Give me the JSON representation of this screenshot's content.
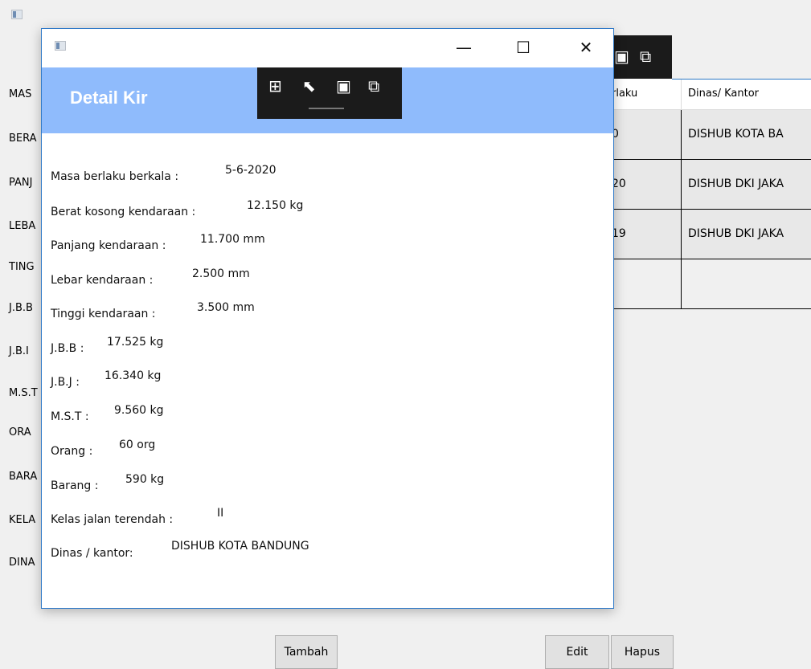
{
  "background_window": {
    "labels": [
      "MAS",
      "BERA",
      "PANJ",
      "LEBA",
      "TING",
      "J.B.B",
      "J.B.I",
      "M.S.T",
      "ORA",
      "BARA",
      "KELA",
      "DINA"
    ],
    "grid": {
      "columns": [
        "rlaku",
        "Dinas/ Kantor"
      ],
      "rows": [
        [
          "0",
          "DISHUB KOTA BA"
        ],
        [
          "20",
          "DISHUB DKI JAKA"
        ],
        [
          "19",
          "DISHUB DKI JAKA"
        ]
      ]
    },
    "buttons": {
      "tambah": "Tambah",
      "edit": "Edit",
      "hapus": "Hapus"
    },
    "toolbar_icons": [
      "frame-icon",
      "select-element-icon"
    ]
  },
  "dialog": {
    "window_buttons": {
      "minimize": "—",
      "maximize": "☐",
      "close": "✕"
    },
    "header_title": "Detail Kir",
    "toolbar_icons": [
      "live-visual-tree-icon",
      "select-element-icon",
      "display-layout-adorners-icon",
      "track-focus-icon"
    ],
    "fields": [
      {
        "label": "Masa berlaku berkala :",
        "value": "5-6-2020"
      },
      {
        "label": "Berat kosong kendaraan :",
        "value": "12.150 kg"
      },
      {
        "label": "Panjang kendaraan :",
        "value": "11.700 mm"
      },
      {
        "label": "Lebar kendaraan :",
        "value": "2.500 mm"
      },
      {
        "label": "Tinggi kendaraan :",
        "value": "3.500 mm"
      },
      {
        "label": "J.B.B :",
        "value": "17.525 kg"
      },
      {
        "label": "J.B.J :",
        "value": "16.340 kg"
      },
      {
        "label": "M.S.T :",
        "value": "9.560 kg"
      },
      {
        "label": "Orang :",
        "value": "60 org"
      },
      {
        "label": "Barang :",
        "value": "590 kg"
      },
      {
        "label": "Kelas jalan terendah :",
        "value": "II"
      },
      {
        "label": "Dinas / kantor:",
        "value": "DISHUB KOTA BANDUNG"
      }
    ]
  },
  "colors": {
    "header_bg": "#8fbbfc",
    "accent_border": "#2f79c8",
    "toolbar_bg": "#1b1b1b"
  }
}
